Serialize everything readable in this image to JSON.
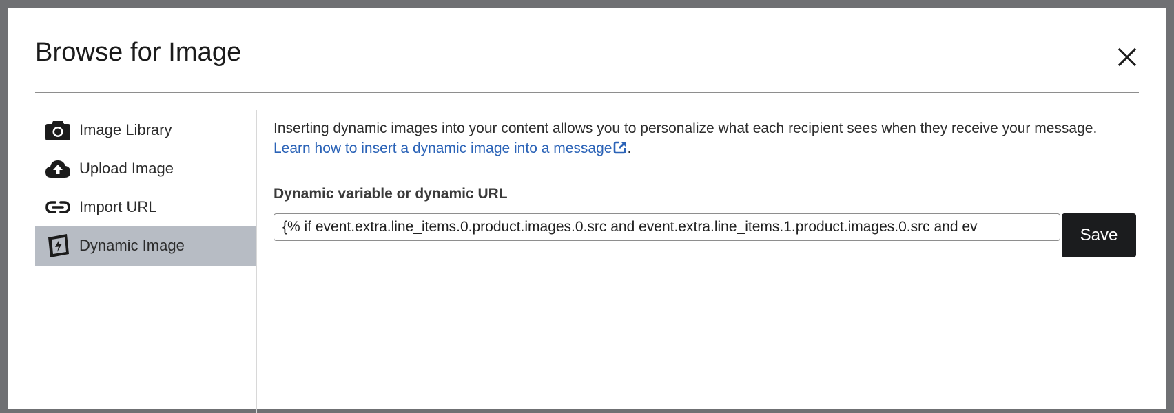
{
  "modal": {
    "title": "Browse for Image",
    "close_icon": "close-icon"
  },
  "sidebar": {
    "items": [
      {
        "label": "Image Library",
        "icon": "camera-icon",
        "active": false
      },
      {
        "label": "Upload Image",
        "icon": "cloud-upload-icon",
        "active": false
      },
      {
        "label": "Import URL",
        "icon": "link-icon",
        "active": false
      },
      {
        "label": "Dynamic Image",
        "icon": "dynamic-image-icon",
        "active": true
      }
    ]
  },
  "content": {
    "intro_text": "Inserting dynamic images into your content allows you to personalize what each recipient sees when they receive your message.",
    "learn_link_text": "Learn how to insert a dynamic image into a message",
    "link_icon": "external-link-icon",
    "trailing_period": ".",
    "field_label": "Dynamic variable or dynamic URL",
    "field_value": "{% if event.extra.line_items.0.product.images.0.src and event.extra.line_items.1.product.images.0.src and ev",
    "save_label": "Save"
  },
  "colors": {
    "overlay": "#6f7073",
    "active_sidebar_bg": "#b7bcc4",
    "link": "#2b63b7",
    "primary_button": "#1b1c1e"
  }
}
